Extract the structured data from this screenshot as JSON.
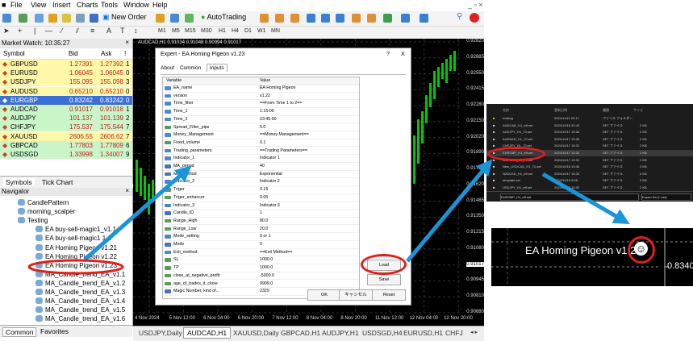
{
  "menu": [
    "File",
    "View",
    "Insert",
    "Charts",
    "Tools",
    "Window",
    "Help"
  ],
  "toolbar": {
    "new_order": "New Order",
    "autotrading": "AutoTrading"
  },
  "timeframes": [
    "M1",
    "M5",
    "M15",
    "M30",
    "H1",
    "H4",
    "D1",
    "W1",
    "MN"
  ],
  "market_watch": {
    "title": "Market Watch: 10:35:27",
    "headers": {
      "symbol": "Symbol",
      "bid": "Bid",
      "ask": "Ask",
      "spread": "!"
    },
    "rows": [
      {
        "symbol": "GBPUSD",
        "bid": "1.27391",
        "ask": "1.27392",
        "spread": "1",
        "bg": "#fff8a8"
      },
      {
        "symbol": "EURUSD",
        "bid": "1.06045",
        "ask": "1.06045",
        "spread": "0",
        "bg": "#fff8a8"
      },
      {
        "symbol": "USDJPY",
        "bid": "155.095",
        "ask": "155.098",
        "spread": "3",
        "bg": "#fff8a8"
      },
      {
        "symbol": "AUDUSD",
        "bid": "0.65210",
        "ask": "0.65210",
        "spread": "0",
        "bg": "#fff8a8"
      },
      {
        "symbol": "EURGBP",
        "bid": "0.83242",
        "ask": "0.83242",
        "spread": "0",
        "bg": "#3b6fd6"
      },
      {
        "symbol": "AUDCAD",
        "bid": "0.91017",
        "ask": "0.91018",
        "spread": "1",
        "bg": "#c9f5c9"
      },
      {
        "symbol": "AUDJPY",
        "bid": "101.137",
        "ask": "101.139",
        "spread": "2",
        "bg": "#c9f5c9"
      },
      {
        "symbol": "CHFJPY",
        "bid": "175.537",
        "ask": "175.544",
        "spread": "7",
        "bg": "#c9f5c9"
      },
      {
        "symbol": "XAUUSD",
        "bid": "2606.55",
        "ask": "2606.62",
        "spread": "7",
        "bg": "#fff8a8"
      },
      {
        "symbol": "GBPCAD",
        "bid": "1.77803",
        "ask": "1.77809",
        "spread": "6",
        "bg": "#c9f5c9"
      },
      {
        "symbol": "USDSGD",
        "bid": "1.33998",
        "ask": "1.34007",
        "spread": "9",
        "bg": "#c9f5c9"
      }
    ],
    "tabs": [
      "Symbols",
      "Tick Chart"
    ]
  },
  "navigator": {
    "title": "Navigator",
    "items": [
      "CandlePattern",
      "morning_scalper",
      "Testing",
      "EA buy-sell-magic1_v1.1",
      "EA buy-sell-magic1 1.1",
      "EA Homing Pigeon v1.21",
      "EA Homing Pigeon v1.22",
      "EA Homing Pigeon v1.23",
      "MA_Candle_trend_EA_v1.1",
      "MA_Candle_trend_EA_v1.2",
      "MA_Candle_trend_EA_v1.3",
      "MA_Candle_trend_EA_v1.4",
      "MA_Candle_trend_EA_v1.5",
      "MA_Candle_trend_EA_v1.6"
    ],
    "tabs": [
      "Common",
      "Favorites"
    ]
  },
  "chart": {
    "header": "AUDCAD,H1  0.91034 0.91048 0.90994 0.91017",
    "prices": [
      "0.92820",
      "0.92685",
      "0.92550",
      "0.92415",
      "0.92280",
      "0.92150",
      "0.92020",
      "0.91890",
      "0.91750",
      "0.91620",
      "0.91485",
      "0.91350",
      "0.91215",
      "0.91080",
      "0.91017",
      "0.90945",
      "0.90810",
      "0.90680"
    ],
    "dates": [
      "4 Nov 2024",
      "5 Nov 12:00",
      "6 Nov 04:00",
      "6 Nov 20:00",
      "7 Nov 12:00",
      "8 Nov 04:00",
      "8 Nov 20:00",
      "11 Nov 12:00",
      "12 Nov 04:00",
      "12 Nov 20:00"
    ],
    "tabs": [
      "USDJPY,Daily",
      "AUDCAD,H1",
      "XAUUSD,Daily",
      "GBPCAD,H1",
      "AUDJPY,H1",
      "USDSGD,H4",
      "EURUSD,H1",
      "CHFJ"
    ]
  },
  "dialog": {
    "title": "Expert - EA Homing Pigeon v1.23",
    "help": "?",
    "close": "X",
    "tabs": [
      "About",
      "Common",
      "Inputs"
    ],
    "header": {
      "variable": "Variable",
      "value": "Value"
    },
    "rows": [
      {
        "var": "EA_name",
        "val": "EA Homing Pigeon",
        "kind": "ab"
      },
      {
        "var": "version",
        "val": "v1.22",
        "kind": "ab"
      },
      {
        "var": "Time_filter",
        "val": "==From Time 1 to 2==",
        "kind": "ab"
      },
      {
        "var": "Time_1",
        "val": "1:15:00",
        "kind": "ab"
      },
      {
        "var": "Time_2",
        "val": "23:45:00",
        "kind": "ab"
      },
      {
        "var": "Spread_Filter_pips",
        "val": "5.0",
        "kind": "num"
      },
      {
        "var": "Money_Management",
        "val": "==Money Management==",
        "kind": "ab"
      },
      {
        "var": "Fixed_volume",
        "val": "0.1",
        "kind": "num"
      },
      {
        "var": "Trading_parameters",
        "val": "==Trading Parameters==",
        "kind": "ab"
      },
      {
        "var": "Indicator_1",
        "val": "Indicator 1",
        "kind": "ab"
      },
      {
        "var": "MA_period",
        "val": "40",
        "kind": "int"
      },
      {
        "var": "MA_method",
        "val": "Exponential",
        "kind": "int"
      },
      {
        "var": "Indicator_2",
        "val": "Indicator 2",
        "kind": "ab"
      },
      {
        "var": "Triger",
        "val": "0.15",
        "kind": "num"
      },
      {
        "var": "Triger_enhancer",
        "val": "0.05",
        "kind": "num"
      },
      {
        "var": "Indicator_3",
        "val": "Indicator 3",
        "kind": "ab"
      },
      {
        "var": "Candle_ID",
        "val": "1",
        "kind": "int"
      },
      {
        "var": "Range_High",
        "val": "80.0",
        "kind": "num"
      },
      {
        "var": "Range_Low",
        "val": "20.0",
        "kind": "num"
      },
      {
        "var": "Mode_setting",
        "val": "0 or 1",
        "kind": "ab"
      },
      {
        "var": "Mode",
        "val": "0",
        "kind": "int"
      },
      {
        "var": "Exit_method",
        "val": "==Exit Method==",
        "kind": "ab"
      },
      {
        "var": "SL",
        "val": "1000.0",
        "kind": "num"
      },
      {
        "var": "TP",
        "val": "1000.0",
        "kind": "num"
      },
      {
        "var": "close_at_negative_profit",
        "val": "-5000.0",
        "kind": "num"
      },
      {
        "var": "age_of_trades_it_close",
        "val": "9999.0",
        "kind": "num"
      },
      {
        "var": "Magic Number, kind of...",
        "val": "2329",
        "kind": "int"
      }
    ],
    "load": "Load",
    "save": "Save",
    "ok": "OK",
    "cancel": "キャンセル",
    "reset": "Reset"
  },
  "explorer": {
    "headers": [
      "名前",
      "更新日時",
      "種類",
      "サイズ"
    ],
    "rows": [
      {
        "name": "making",
        "date": "2024/11/19 20:17",
        "type": "ファイル フォルダー",
        "size": ""
      },
      {
        "name": "AUDCAD_H1_eff.set",
        "date": "2024/10/16 20:43",
        "type": "SET ファイル",
        "size": "2 KB"
      },
      {
        "name": "AUDJPY_H1_70.set",
        "date": "2024/10/17 15:36",
        "type": "SET ファイル",
        "size": "2 KB"
      },
      {
        "name": "AUDNZD_H1_70.set",
        "date": "2024/10/17 15:36",
        "type": "SET ファイル",
        "size": "2 KB"
      },
      {
        "name": "CHFJPY_H1_70.set",
        "date": "2024/10/17 15:31",
        "type": "SET ファイル",
        "size": "2 KB"
      },
      {
        "name": "EURGBP_H1_eff.set",
        "date": "2024/10/17 15:32",
        "type": "SET ファイル",
        "size": "2 KB"
      },
      {
        "name": "GBPCAD_H1_70.set",
        "date": "2024/10/17 15:32",
        "type": "SET ファイル",
        "size": "2 KB"
      },
      {
        "name": "New_USDCAD_H1_70.set",
        "date": "2024/10/18 15:46",
        "type": "SET ファイル",
        "size": "2 KB"
      },
      {
        "name": "NZDUSD_H1_eff.set",
        "date": "2024/10/17 15:34",
        "type": "SET ファイル",
        "size": "2 KB"
      },
      {
        "name": "template.set",
        "date": "2024/10/19 9:05",
        "type": "SET ファイル",
        "size": "2 KB"
      },
      {
        "name": "USDJPY_H1_eff.set",
        "date": "2024/10/17 15:30",
        "type": "SET ファイル",
        "size": "2 KB"
      }
    ],
    "filename": "EURGBP_H1_eff.set",
    "filter": "Expert Set (*.set)"
  },
  "zoom": {
    "label": "EA Homing Pigeon v1.23",
    "price": "0.8340"
  },
  "colors": {
    "up": "#00c800",
    "grid": "#2e2e2e",
    "accent": "#e41d1d",
    "arrow": "#1a95d8"
  }
}
